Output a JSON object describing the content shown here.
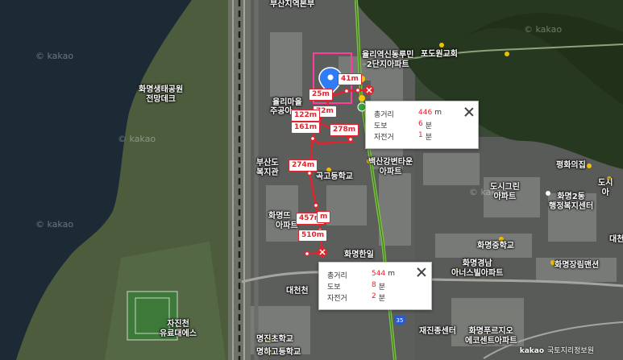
{
  "map_labels": [
    {
      "key": "busan_jiyeok",
      "text": "부산지역본부"
    },
    {
      "key": "yulli_apt",
      "text": "율리역신동루민\n2단지아파트"
    },
    {
      "key": "podowon",
      "text": "포도원교회"
    },
    {
      "key": "yulli_village",
      "text": "율리마을"
    },
    {
      "key": "jugong",
      "text": "주공아"
    },
    {
      "key": "hwamyeong_park",
      "text": "화명생태공원\n전망데크"
    },
    {
      "key": "busan_welfare",
      "text": "부산도"
    },
    {
      "key": "welfare",
      "text": "복지관"
    },
    {
      "key": "gokdong_school",
      "text": "곡고등학교"
    },
    {
      "key": "baeksan_apt",
      "text": "백산강변타운\n아파트"
    },
    {
      "key": "hwamyeong_tu",
      "text": "화명뜨"
    },
    {
      "key": "apt_left",
      "text": "아파트"
    },
    {
      "key": "hwamyeong_hanil",
      "text": "화명한일"
    },
    {
      "key": "pyeonghwa",
      "text": "평화의집"
    },
    {
      "key": "dosi_green",
      "text": "도시그린\n아파트"
    },
    {
      "key": "hwamyeong2",
      "text": "화명2동\n행정복지센터"
    },
    {
      "key": "dosi_right",
      "text": "도시\n아"
    },
    {
      "key": "hwamyeong_middle",
      "text": "화명중학교"
    },
    {
      "key": "hwamyeong_jangrim",
      "text": "화명장림맨션"
    },
    {
      "key": "hwamyeong_gyeongnam",
      "text": "화명경남\n아너스빌아파트"
    },
    {
      "key": "daecheon",
      "text": "대천천"
    },
    {
      "key": "jaejin_center",
      "text": "재진종센터"
    },
    {
      "key": "hwamyeong_purun",
      "text": "화명푸르지오\n에코센트아파트"
    },
    {
      "key": "jaejin_stadium",
      "text": "자진천\n유료대에스"
    },
    {
      "key": "myeongjin_elem",
      "text": "명진초학교"
    },
    {
      "key": "myeongjin_high",
      "text": "명하고등학교"
    },
    {
      "key": "dae_right",
      "text": "대천"
    }
  ],
  "watermarks": [
    "© kakao",
    "© kakao",
    "© kakao",
    "© kakao",
    "© kakao"
  ],
  "distances": [
    "25m",
    "41m",
    "72m",
    "122m",
    "161m",
    "278m",
    "274m",
    "457m",
    "510m",
    "m"
  ],
  "highway_number": "35",
  "info_card_1": {
    "rows": [
      {
        "key": "총거리",
        "value": "446",
        "unit": "m"
      },
      {
        "key": "도보",
        "value": "6",
        "unit": "분"
      },
      {
        "key": "자전거",
        "value": "1",
        "unit": "분"
      }
    ]
  },
  "info_card_2": {
    "rows": [
      {
        "key": "총거리",
        "value": "544",
        "unit": "m"
      },
      {
        "key": "도보",
        "value": "8",
        "unit": "분"
      },
      {
        "key": "자전거",
        "value": "2",
        "unit": "분"
      }
    ]
  },
  "footer": {
    "brand": "kakao",
    "copyright": "국토지리정보원"
  },
  "colors": {
    "route": "#e0242f",
    "area_outline": "#ff3d9a",
    "river": "#1c2a36",
    "green_road": "#79c142"
  }
}
